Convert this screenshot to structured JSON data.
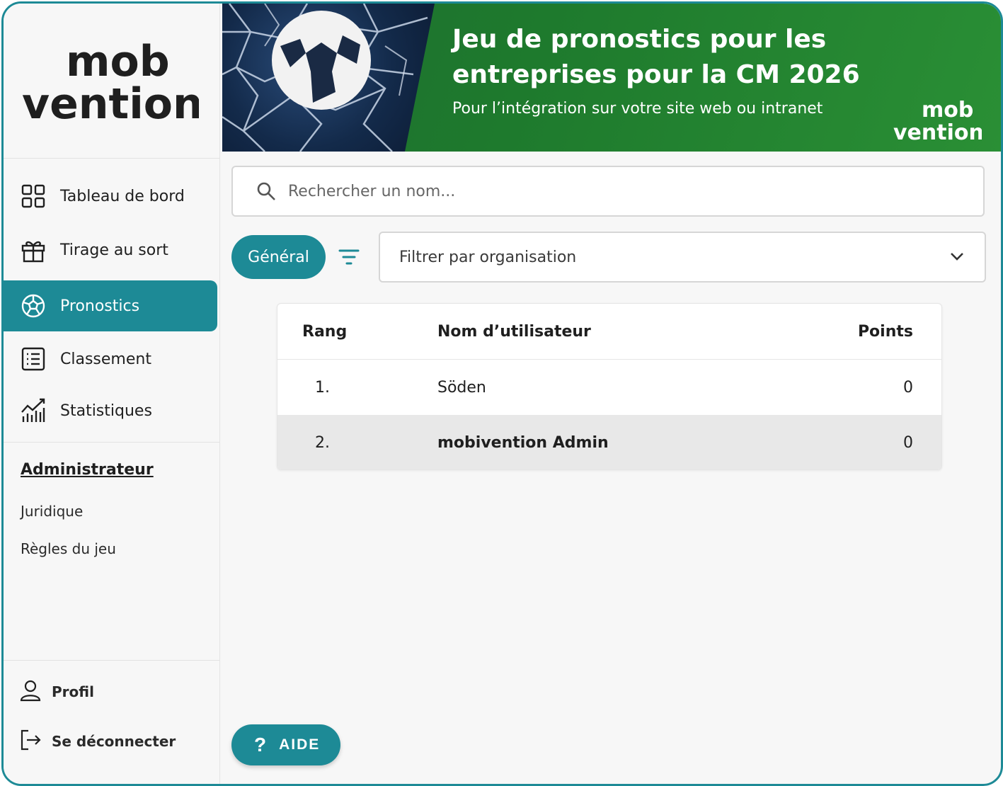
{
  "brand": {
    "logo_line1": "mob",
    "logo_line2": "vention",
    "accent_color": "#1d8a96"
  },
  "sidebar": {
    "items": [
      {
        "label": "Tableau de bord",
        "icon": "dashboard-grid-icon",
        "active": false
      },
      {
        "label": "Tirage au sort",
        "icon": "gift-icon",
        "active": false
      },
      {
        "label": "Pronostics",
        "icon": "soccer-ball-icon",
        "active": true
      },
      {
        "label": "Classement",
        "icon": "list-icon",
        "active": false
      },
      {
        "label": "Statistiques",
        "icon": "chart-icon",
        "active": false
      }
    ],
    "admin_title": "Administrateur",
    "admin_links": [
      "Juridique",
      "Règles du jeu"
    ],
    "bottom": {
      "profile_label": "Profil",
      "logout_label": "Se déconnecter"
    }
  },
  "banner": {
    "title": "Jeu de pronostics pour les entreprises pour la CM 2026",
    "subtitle": "Pour l’intégration sur votre site web ou intranet",
    "logo_line1": "mob",
    "logo_line2": "vention",
    "background_color": "#1f7a2d"
  },
  "search": {
    "placeholder": "Rechercher un nom..."
  },
  "filters": {
    "general_label": "Général",
    "org_placeholder": "Filtrer par organisation"
  },
  "table": {
    "headers": {
      "rank": "Rang",
      "name": "Nom d’utilisateur",
      "points": "Points"
    },
    "rows": [
      {
        "rank": "1.",
        "name": "Söden",
        "points": "0"
      },
      {
        "rank": "2.",
        "name": "mobivention Admin",
        "points": "0"
      }
    ]
  },
  "help": {
    "icon": "?",
    "label": "AIDE"
  }
}
